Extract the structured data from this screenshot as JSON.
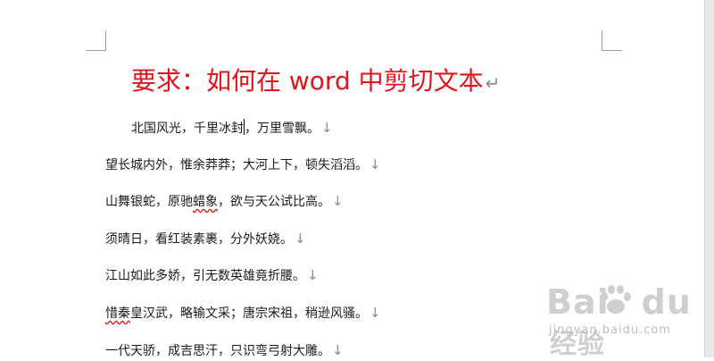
{
  "document": {
    "title": "要求：如何在 word 中剪切文本",
    "paragraph_mark": "↵",
    "line_break_mark": "↓",
    "lines": [
      {
        "before_caret": "北国风光，千里冰封",
        "after_caret": "，万里雪飘。"
      },
      {
        "text": "望长城内外，惟余莽莽；大河上下，顿失滔滔。"
      },
      {
        "before": "山舞银蛇，原驰",
        "squiggle": "蜡象",
        "after": "，欲与天公试比高。"
      },
      {
        "text": "须晴日，看红装素裹，分外妖娆。"
      },
      {
        "text": "江山如此多娇，引无数英雄竟折腰。"
      },
      {
        "squiggle": "惜秦",
        "after": "皇汉武，略输文采；唐宗宋祖，稍逊风骚。"
      },
      {
        "text": "一代天骄，成吉思汗，只识弯弓射大雕。"
      }
    ]
  },
  "watermark": {
    "brand": "Bai",
    "brand_suffix": "du",
    "brand_cn": "经验",
    "url": "jingyan.baidu.com"
  },
  "colors": {
    "title": "#e0141c",
    "spellcheck": "#e02020",
    "marks": "#8a8a8a"
  }
}
